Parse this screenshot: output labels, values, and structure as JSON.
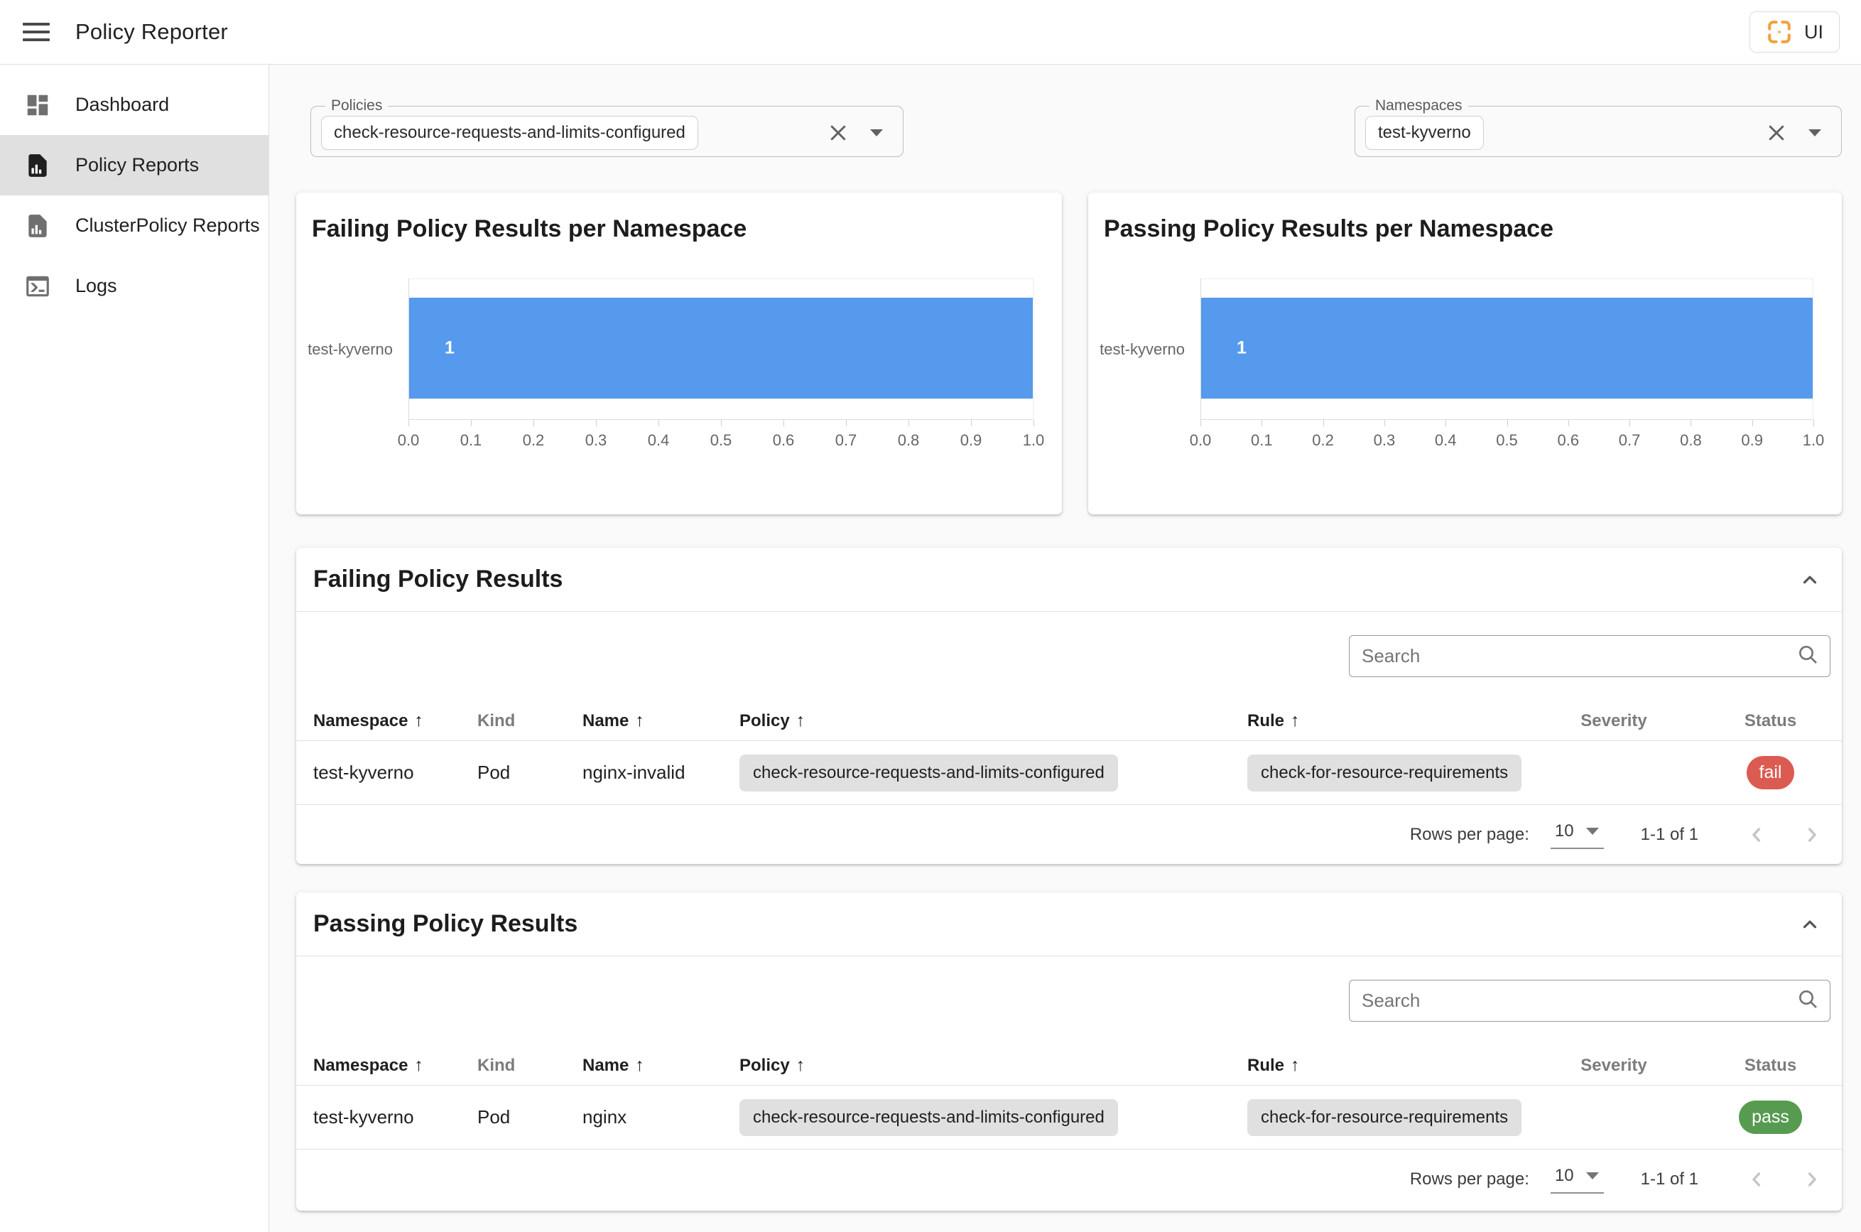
{
  "header": {
    "title": "Policy Reporter",
    "ui_button_label": "UI"
  },
  "sidebar": {
    "items": [
      {
        "label": "Dashboard",
        "active": false
      },
      {
        "label": "Policy Reports",
        "active": true
      },
      {
        "label": "ClusterPolicy Reports",
        "active": false
      },
      {
        "label": "Logs",
        "active": false
      }
    ]
  },
  "filters": {
    "policies": {
      "label": "Policies",
      "selected": "check-resource-requests-and-limits-configured"
    },
    "namespaces": {
      "label": "Namespaces",
      "selected": "test-kyverno"
    }
  },
  "chart_data": [
    {
      "type": "bar",
      "orientation": "horizontal",
      "title": "Failing Policy Results per Namespace",
      "categories": [
        "test-kyverno"
      ],
      "values": [
        1
      ],
      "value_labels": [
        "1"
      ],
      "xlim": [
        0,
        1
      ],
      "xtick_labels": [
        "0.0",
        "0.1",
        "0.2",
        "0.3",
        "0.4",
        "0.5",
        "0.6",
        "0.7",
        "0.8",
        "0.9",
        "1.0"
      ],
      "bar_color": "#559aed",
      "grid": false,
      "legend": false
    },
    {
      "type": "bar",
      "orientation": "horizontal",
      "title": "Passing Policy Results per Namespace",
      "categories": [
        "test-kyverno"
      ],
      "values": [
        1
      ],
      "value_labels": [
        "1"
      ],
      "xlim": [
        0,
        1
      ],
      "xtick_labels": [
        "0.0",
        "0.1",
        "0.2",
        "0.3",
        "0.4",
        "0.5",
        "0.6",
        "0.7",
        "0.8",
        "0.9",
        "1.0"
      ],
      "bar_color": "#559aed",
      "grid": false,
      "legend": false
    }
  ],
  "sections": [
    {
      "title": "Failing Policy Results",
      "search_placeholder": "Search",
      "columns": {
        "namespace": "Namespace",
        "kind": "Kind",
        "name": "Name",
        "policy": "Policy",
        "rule": "Rule",
        "severity": "Severity",
        "status": "Status"
      },
      "row": {
        "namespace": "test-kyverno",
        "kind": "Pod",
        "name": "nginx-invalid",
        "policy": "check-resource-requests-and-limits-configured",
        "rule": "check-for-resource-requirements",
        "severity": "",
        "status": "fail"
      },
      "pagination": {
        "label": "Rows per page:",
        "value": "10",
        "range": "1-1 of 1"
      }
    },
    {
      "title": "Passing Policy Results",
      "search_placeholder": "Search",
      "columns": {
        "namespace": "Namespace",
        "kind": "Kind",
        "name": "Name",
        "policy": "Policy",
        "rule": "Rule",
        "severity": "Severity",
        "status": "Status"
      },
      "row": {
        "namespace": "test-kyverno",
        "kind": "Pod",
        "name": "nginx",
        "policy": "check-resource-requests-and-limits-configured",
        "rule": "check-for-resource-requirements",
        "severity": "",
        "status": "pass"
      },
      "pagination": {
        "label": "Rows per page:",
        "value": "10",
        "range": "1-1 of 1"
      }
    }
  ],
  "colors": {
    "bar_blue": "#559aed",
    "fail_badge": "#db5b52",
    "pass_badge": "#579b51",
    "logo_orange": "#f0a33e",
    "active_nav_bg": "#e0e0e0"
  }
}
